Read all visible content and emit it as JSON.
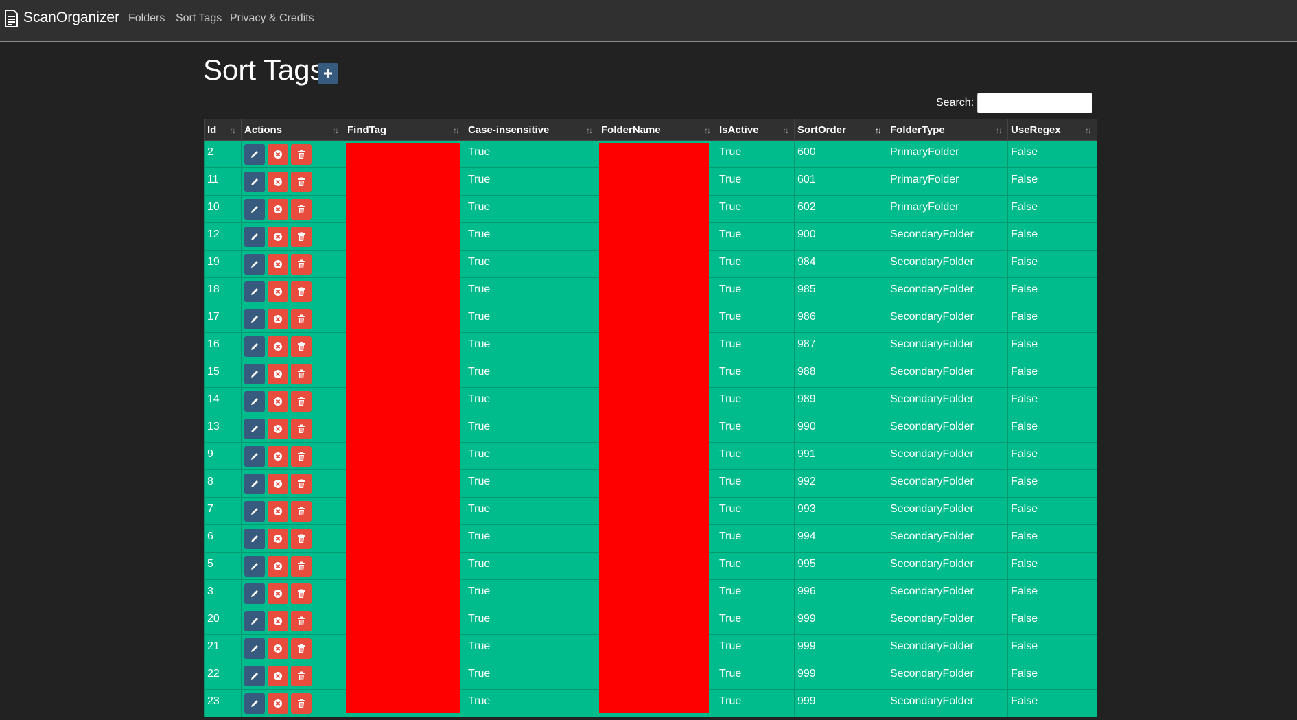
{
  "navbar": {
    "brand": "ScanOrganizer",
    "brand_icon": "document-icon",
    "links": [
      "Folders",
      "Sort Tags",
      "Privacy & Credits"
    ]
  },
  "page": {
    "title": "Sort Tags",
    "add_button_icon": "plus-icon"
  },
  "search": {
    "label": "Search:",
    "value": ""
  },
  "table": {
    "columns": [
      "Id",
      "Actions",
      "FindTag",
      "Case-insensitive",
      "FolderName",
      "IsActive",
      "SortOrder",
      "FolderType",
      "UseRegex"
    ],
    "sorted_column": "SortOrder",
    "action_icons": [
      "pencil-icon",
      "close-circle-icon",
      "trash-icon"
    ],
    "redacted_columns": [
      "FindTag",
      "FolderName"
    ],
    "rows": [
      {
        "id": "2",
        "case_insensitive": "True",
        "is_active": "True",
        "sort_order": "600",
        "folder_type": "PrimaryFolder",
        "use_regex": "False"
      },
      {
        "id": "11",
        "case_insensitive": "True",
        "is_active": "True",
        "sort_order": "601",
        "folder_type": "PrimaryFolder",
        "use_regex": "False"
      },
      {
        "id": "10",
        "case_insensitive": "True",
        "is_active": "True",
        "sort_order": "602",
        "folder_type": "PrimaryFolder",
        "use_regex": "False"
      },
      {
        "id": "12",
        "case_insensitive": "True",
        "is_active": "True",
        "sort_order": "900",
        "folder_type": "SecondaryFolder",
        "use_regex": "False"
      },
      {
        "id": "19",
        "case_insensitive": "True",
        "is_active": "True",
        "sort_order": "984",
        "folder_type": "SecondaryFolder",
        "use_regex": "False"
      },
      {
        "id": "18",
        "case_insensitive": "True",
        "is_active": "True",
        "sort_order": "985",
        "folder_type": "SecondaryFolder",
        "use_regex": "False"
      },
      {
        "id": "17",
        "case_insensitive": "True",
        "is_active": "True",
        "sort_order": "986",
        "folder_type": "SecondaryFolder",
        "use_regex": "False"
      },
      {
        "id": "16",
        "case_insensitive": "True",
        "is_active": "True",
        "sort_order": "987",
        "folder_type": "SecondaryFolder",
        "use_regex": "False"
      },
      {
        "id": "15",
        "case_insensitive": "True",
        "is_active": "True",
        "sort_order": "988",
        "folder_type": "SecondaryFolder",
        "use_regex": "False"
      },
      {
        "id": "14",
        "case_insensitive": "True",
        "is_active": "True",
        "sort_order": "989",
        "folder_type": "SecondaryFolder",
        "use_regex": "False"
      },
      {
        "id": "13",
        "case_insensitive": "True",
        "is_active": "True",
        "sort_order": "990",
        "folder_type": "SecondaryFolder",
        "use_regex": "False"
      },
      {
        "id": "9",
        "case_insensitive": "True",
        "is_active": "True",
        "sort_order": "991",
        "folder_type": "SecondaryFolder",
        "use_regex": "False"
      },
      {
        "id": "8",
        "case_insensitive": "True",
        "is_active": "True",
        "sort_order": "992",
        "folder_type": "SecondaryFolder",
        "use_regex": "False"
      },
      {
        "id": "7",
        "case_insensitive": "True",
        "is_active": "True",
        "sort_order": "993",
        "folder_type": "SecondaryFolder",
        "use_regex": "False"
      },
      {
        "id": "6",
        "case_insensitive": "True",
        "is_active": "True",
        "sort_order": "994",
        "folder_type": "SecondaryFolder",
        "use_regex": "False"
      },
      {
        "id": "5",
        "case_insensitive": "True",
        "is_active": "True",
        "sort_order": "995",
        "folder_type": "SecondaryFolder",
        "use_regex": "False"
      },
      {
        "id": "3",
        "case_insensitive": "True",
        "is_active": "True",
        "sort_order": "996",
        "folder_type": "SecondaryFolder",
        "use_regex": "False"
      },
      {
        "id": "20",
        "case_insensitive": "True",
        "is_active": "True",
        "sort_order": "999",
        "folder_type": "SecondaryFolder",
        "use_regex": "False"
      },
      {
        "id": "21",
        "case_insensitive": "True",
        "is_active": "True",
        "sort_order": "999",
        "folder_type": "SecondaryFolder",
        "use_regex": "False"
      },
      {
        "id": "22",
        "case_insensitive": "True",
        "is_active": "True",
        "sort_order": "999",
        "folder_type": "SecondaryFolder",
        "use_regex": "False"
      },
      {
        "id": "23",
        "case_insensitive": "True",
        "is_active": "True",
        "sort_order": "999",
        "folder_type": "SecondaryFolder",
        "use_regex": "False"
      }
    ]
  },
  "colors": {
    "navbar_bg": "#303030",
    "page_bg": "#222222",
    "row_bg": "#00bc8c",
    "primary_button": "#375a7f",
    "danger_button": "#e74c3c",
    "redaction": "#ff0000"
  }
}
